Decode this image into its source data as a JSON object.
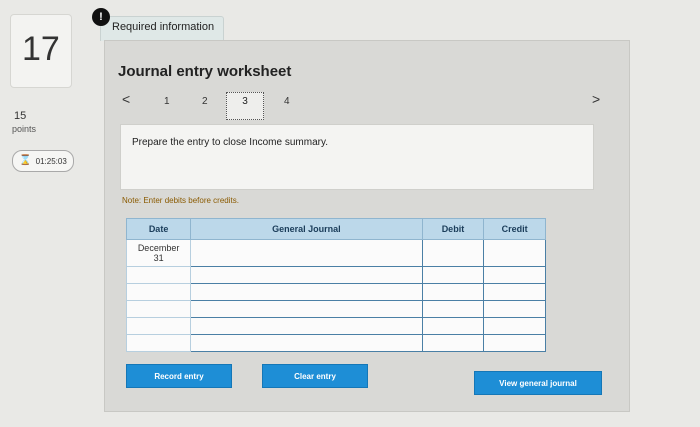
{
  "question": {
    "number": "17",
    "points_value": "15",
    "points_label": "points",
    "timer": "01:25:03",
    "timer_icon": "hourglass-icon"
  },
  "header": {
    "required_label": "Required information",
    "title": "Journal entry worksheet"
  },
  "nav": {
    "prev": "<",
    "next": ">",
    "steps": [
      "1",
      "2",
      "3",
      "4"
    ],
    "active_step": "3"
  },
  "prompt": "Prepare the entry to close Income summary.",
  "note": "Note: Enter debits before credits.",
  "journal": {
    "headers": {
      "date": "Date",
      "general_journal": "General Journal",
      "debit": "Debit",
      "credit": "Credit"
    },
    "first_date_line1": "December",
    "first_date_line2": "31"
  },
  "buttons": {
    "record": "Record entry",
    "clear": "Clear entry",
    "view": "View general journal"
  },
  "colors": {
    "header_blue": "#bcd8ea",
    "button_blue": "#1e8ed6",
    "note_color": "#8a5a00"
  }
}
